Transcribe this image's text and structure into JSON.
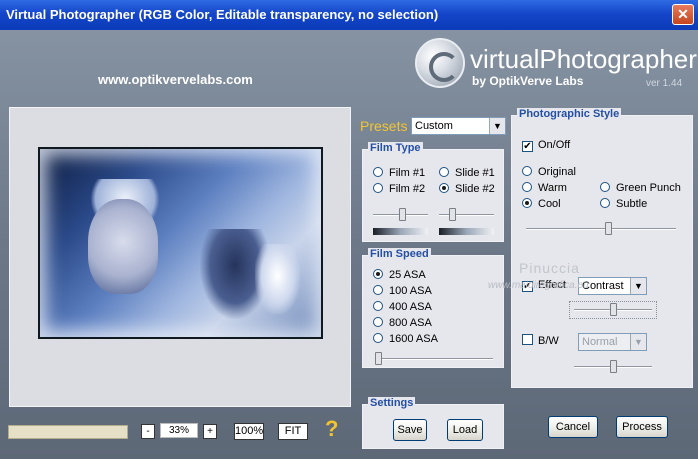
{
  "window": {
    "title": "Virtual Photographer (RGB Color, Editable transparency, no selection)",
    "close_glyph": "✕"
  },
  "brand": {
    "url": "www.optikvervelabs.com",
    "logo": "virtualPhotographer",
    "byline": "by OptikVerve Labs",
    "version": "ver 1.44"
  },
  "presets": {
    "label": "Presets",
    "value": "Custom"
  },
  "film_type": {
    "title": "Film Type",
    "options": [
      {
        "label": "Film #1",
        "selected": false
      },
      {
        "label": "Slide #1",
        "selected": false
      },
      {
        "label": "Film #2",
        "selected": false
      },
      {
        "label": "Slide #2",
        "selected": true
      }
    ],
    "left_slider": 0.55,
    "right_slider": 0.2
  },
  "film_speed": {
    "title": "Film Speed",
    "options": [
      {
        "label": "25 ASA",
        "selected": true
      },
      {
        "label": "100 ASA",
        "selected": false
      },
      {
        "label": "400 ASA",
        "selected": false
      },
      {
        "label": "800 ASA",
        "selected": false
      },
      {
        "label": "1600 ASA",
        "selected": false
      }
    ],
    "slider": 0.0
  },
  "settings": {
    "title": "Settings",
    "save_label": "Save",
    "load_label": "Load"
  },
  "photographic_style": {
    "title": "Photographic Style",
    "on_off_label": "On/Off",
    "on_off_checked": true,
    "options": [
      {
        "label": "Original",
        "selected": false
      },
      {
        "label": "Warm",
        "selected": false
      },
      {
        "label": "Green Punch",
        "selected": false
      },
      {
        "label": "Cool",
        "selected": true
      },
      {
        "label": "Subtle",
        "selected": false
      }
    ],
    "slider": 0.55,
    "effect_label": "Effect",
    "effect_checked": true,
    "effect_value": "Contrast",
    "effect_slider": 0.5,
    "bw_label": "B/W",
    "bw_checked": false,
    "bw_value": "Normal",
    "bw_slider": 0.5
  },
  "zoom": {
    "minus": "-",
    "value": "33%",
    "plus": "+",
    "full_label": "100%",
    "fit_label": "FIT",
    "help": "?"
  },
  "actions": {
    "cancel_label": "Cancel",
    "process_label": "Process"
  },
  "watermark": {
    "name": "Pinuccia",
    "site": "www.maidiregrafica.eu"
  },
  "colors": {
    "title_bar": "#1446c9",
    "group_title": "#244fa5",
    "presets_label": "#f4c530",
    "panel_bg": "#e6e7ec"
  }
}
